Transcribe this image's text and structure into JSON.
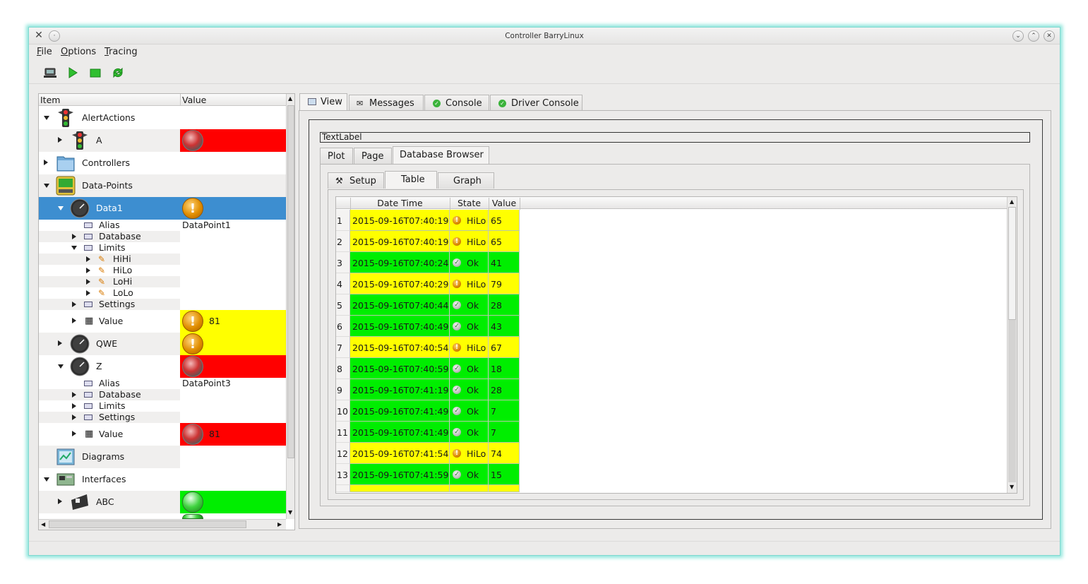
{
  "window": {
    "title": "Controller BarryLinux"
  },
  "menu": [
    "File",
    "Options",
    "Tracing"
  ],
  "toolbar": [
    "computer-icon",
    "play-icon",
    "stop-icon",
    "refresh-icon"
  ],
  "tree": {
    "headers": {
      "item": "Item",
      "value": "Value"
    },
    "rows": [
      {
        "label": "AlertActions",
        "value": ""
      },
      {
        "label": "A",
        "value": ""
      },
      {
        "label": "Controllers",
        "value": ""
      },
      {
        "label": "Data-Points",
        "value": ""
      },
      {
        "label": "Data1",
        "value": ""
      },
      {
        "label": "Alias",
        "value": "DataPoint1"
      },
      {
        "label": "Database",
        "value": ""
      },
      {
        "label": "Limits",
        "value": ""
      },
      {
        "label": "HiHi",
        "value": ""
      },
      {
        "label": "HiLo",
        "value": ""
      },
      {
        "label": "LoHi",
        "value": ""
      },
      {
        "label": "LoLo",
        "value": ""
      },
      {
        "label": "Settings",
        "value": ""
      },
      {
        "label": "Value",
        "value": "81"
      },
      {
        "label": "QWE",
        "value": ""
      },
      {
        "label": "Z",
        "value": ""
      },
      {
        "label": "Alias",
        "value": "DataPoint3"
      },
      {
        "label": "Database",
        "value": ""
      },
      {
        "label": "Limits",
        "value": ""
      },
      {
        "label": "Settings",
        "value": ""
      },
      {
        "label": "Value",
        "value": "81"
      },
      {
        "label": "Diagrams",
        "value": ""
      },
      {
        "label": "Interfaces",
        "value": ""
      },
      {
        "label": "ABC",
        "value": ""
      }
    ]
  },
  "tabs": [
    "View",
    "Messages",
    "Console",
    "Driver Console"
  ],
  "textlabel": "TextLabel",
  "subtabs": [
    "Plot",
    "Page",
    "Database Browser"
  ],
  "innertabs": [
    "Setup",
    "Table",
    "Graph"
  ],
  "table": {
    "headers": [
      "Date Time",
      "State",
      "Value"
    ],
    "rows": [
      {
        "n": "1",
        "dt": "2015-09-16T07:40:19",
        "state": "HiLo",
        "value": "65"
      },
      {
        "n": "2",
        "dt": "2015-09-16T07:40:19",
        "state": "HiLo",
        "value": "65"
      },
      {
        "n": "3",
        "dt": "2015-09-16T07:40:24",
        "state": "Ok",
        "value": "41"
      },
      {
        "n": "4",
        "dt": "2015-09-16T07:40:29",
        "state": "HiLo",
        "value": "79"
      },
      {
        "n": "5",
        "dt": "2015-09-16T07:40:44",
        "state": "Ok",
        "value": "28"
      },
      {
        "n": "6",
        "dt": "2015-09-16T07:40:49",
        "state": "Ok",
        "value": "43"
      },
      {
        "n": "7",
        "dt": "2015-09-16T07:40:54",
        "state": "HiLo",
        "value": "67"
      },
      {
        "n": "8",
        "dt": "2015-09-16T07:40:59",
        "state": "Ok",
        "value": "18"
      },
      {
        "n": "9",
        "dt": "2015-09-16T07:41:19",
        "state": "Ok",
        "value": "28"
      },
      {
        "n": "10",
        "dt": "2015-09-16T07:41:49",
        "state": "Ok",
        "value": "7"
      },
      {
        "n": "11",
        "dt": "2015-09-16T07:41:49",
        "state": "Ok",
        "value": "7"
      },
      {
        "n": "12",
        "dt": "2015-09-16T07:41:54",
        "state": "HiLo",
        "value": "74"
      },
      {
        "n": "13",
        "dt": "2015-09-16T07:41:59",
        "state": "Ok",
        "value": "15"
      }
    ]
  },
  "colors": {
    "ok": "#00ee00",
    "warn": "#ffff00",
    "alarm": "#ff0000",
    "selection": "#3d8ed0"
  }
}
